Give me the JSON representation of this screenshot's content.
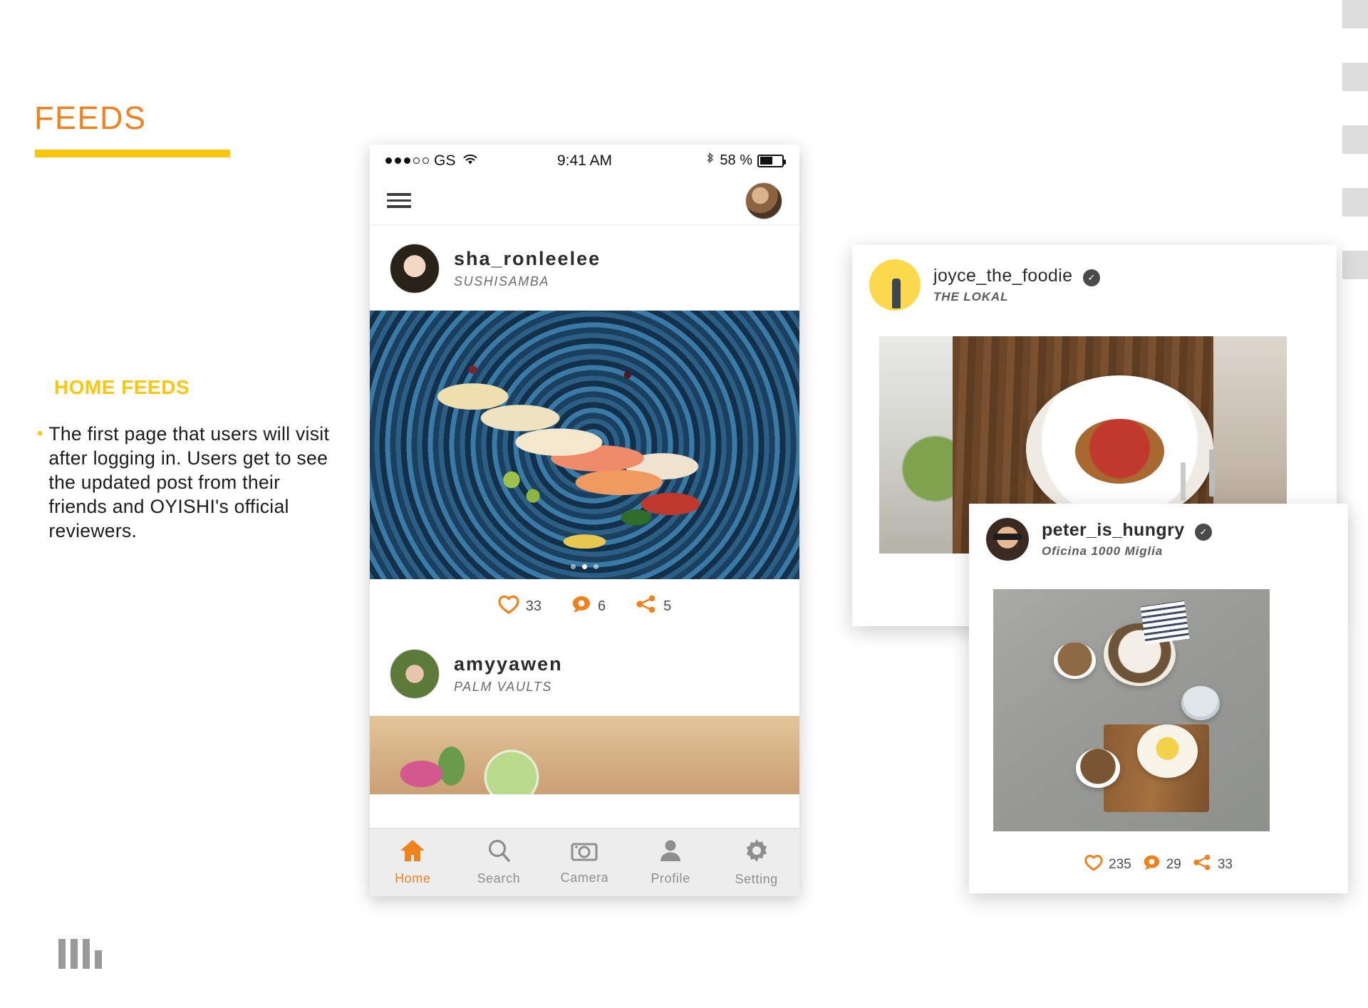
{
  "slide": {
    "title": "FEEDS",
    "section_heading": "HOME FEEDS",
    "bullet": "The first page that users will visit after logging in. Users get to see the updated post from their friends and OYISHI's official reviewers.",
    "accent_orange": "#F0821E",
    "accent_yellow": "#FCC60C"
  },
  "phone": {
    "status_bar": {
      "carrier": "GS",
      "signal_dots_filled": 3,
      "signal_dots_total": 5,
      "time": "9:41 AM",
      "battery_percent": "58 %",
      "battery_level": 58,
      "bluetooth_icon": "bluetooth-icon",
      "wifi_icon": "wifi-icon"
    },
    "app_bar": {
      "menu_icon": "hamburger-menu-icon",
      "avatar": "user-avatar"
    },
    "posts": [
      {
        "username": "sha_ronleelee",
        "venue": "SUSHISAMBA",
        "likes": "33",
        "comments": "6",
        "shares": "5",
        "carousel_dots": 3,
        "carousel_active": 1
      },
      {
        "username": "amyyawen",
        "venue": "PALM VAULTS"
      }
    ],
    "tabbar": [
      {
        "label": "Home",
        "icon": "home-icon",
        "active": true
      },
      {
        "label": "Search",
        "icon": "search-icon",
        "active": false
      },
      {
        "label": "Camera",
        "icon": "camera-icon",
        "active": false
      },
      {
        "label": "Profile",
        "icon": "profile-icon",
        "active": false
      },
      {
        "label": "Setting",
        "icon": "gear-icon",
        "active": false
      }
    ]
  },
  "cards": [
    {
      "username": "joyce_the_foodie",
      "venue": "THE LOKAL",
      "verified": true,
      "verified_icon": "verified-check-icon"
    },
    {
      "username": "peter_is_hungry",
      "venue": "Oficina 1000 Miglia",
      "verified": true,
      "verified_icon": "verified-check-icon",
      "likes": "235",
      "comments": "29",
      "shares": "33"
    }
  ],
  "icons": {
    "heart": "heart-icon",
    "comment": "comment-bubble-icon",
    "share": "share-icon"
  }
}
